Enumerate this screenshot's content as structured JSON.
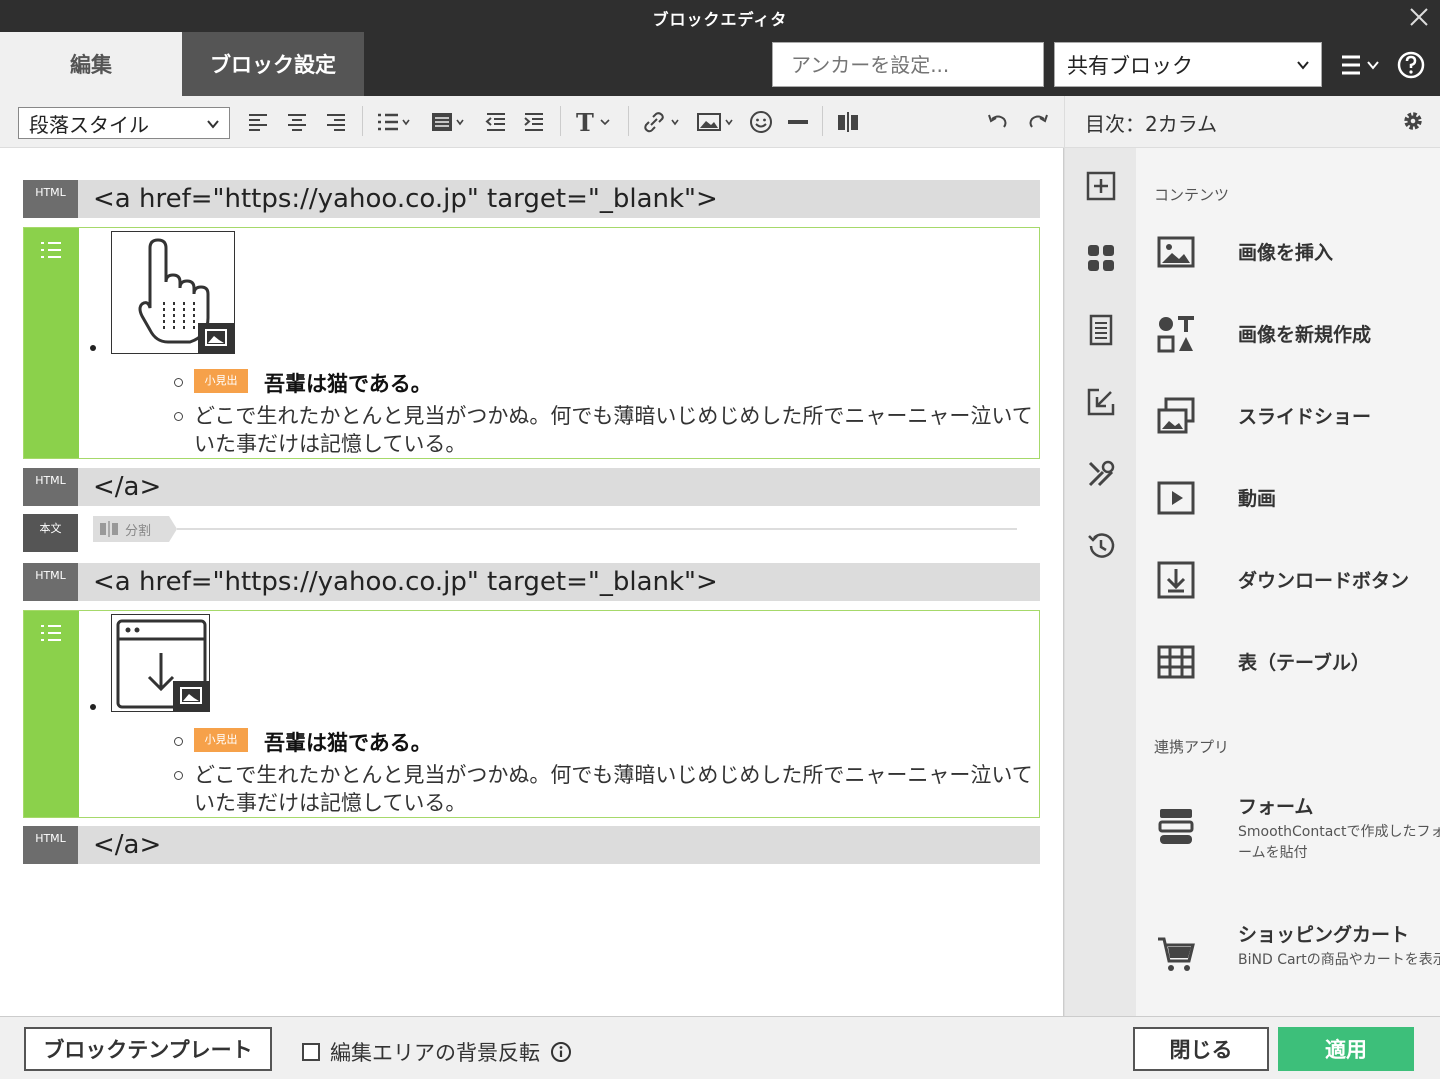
{
  "window": {
    "title": "ブロックエディタ"
  },
  "header": {
    "tabs": [
      {
        "label": "編集"
      },
      {
        "label": "ブロック設定"
      }
    ],
    "anchor_placeholder": "アンカーを設定...",
    "shared_block": "共有ブロック"
  },
  "toolbar": {
    "paragraph_style": "段落スタイル",
    "text_tool": "T"
  },
  "panel": {
    "title": "目次：2カラム",
    "contents_section": "コンテンツ",
    "items": [
      {
        "label": "画像を挿入",
        "icon": "image-icon"
      },
      {
        "label": "画像を新規作成",
        "icon": "shapes-icon"
      },
      {
        "label": "スライドショー",
        "icon": "slideshow-icon"
      },
      {
        "label": "動画",
        "icon": "video-icon"
      },
      {
        "label": "ダウンロードボタン",
        "icon": "download-icon"
      },
      {
        "label": "表（テーブル）",
        "icon": "table-icon"
      }
    ],
    "apps_section": "連携アプリ",
    "apps": [
      {
        "label": "フォーム",
        "desc": "SmoothContactで作成したフォームを貼付",
        "icon": "form-icon"
      },
      {
        "label": "ショッピングカート",
        "desc": "BiND Cartの商品やカートを表示",
        "icon": "cart-icon"
      }
    ]
  },
  "editor": {
    "html_tag": "HTML",
    "body_tag": "本文",
    "split_label": "分割",
    "midasi": "小見出",
    "blocks": [
      {
        "open": "<a href=\"https://yahoo.co.jp\" target=\"_blank\">",
        "heading": "吾輩は猫である。",
        "text": "どこで生れたかとんと見当がつかぬ。何でも薄暗いじめじめした所でニャーニャー泣いていた事だけは記憶している。",
        "close": "</a>"
      },
      {
        "open": "<a href=\"https://yahoo.co.jp\" target=\"_blank\">",
        "heading": "吾輩は猫である。",
        "text": "どこで生れたかとんと見当がつかぬ。何でも薄暗いじめじめした所でニャーニャー泣いていた事だけは記憶している。",
        "close": "</a>"
      }
    ]
  },
  "footer": {
    "template_button": "ブロックテンプレート",
    "invert_label": "編集エリアの背景反転",
    "close_button": "閉じる",
    "apply_button": "適用"
  },
  "colors": {
    "dark": "#2f2f2f",
    "accent_green": "#8bd14b",
    "apply_green": "#3dbf7a",
    "midasi_orange": "#f6a14a"
  }
}
